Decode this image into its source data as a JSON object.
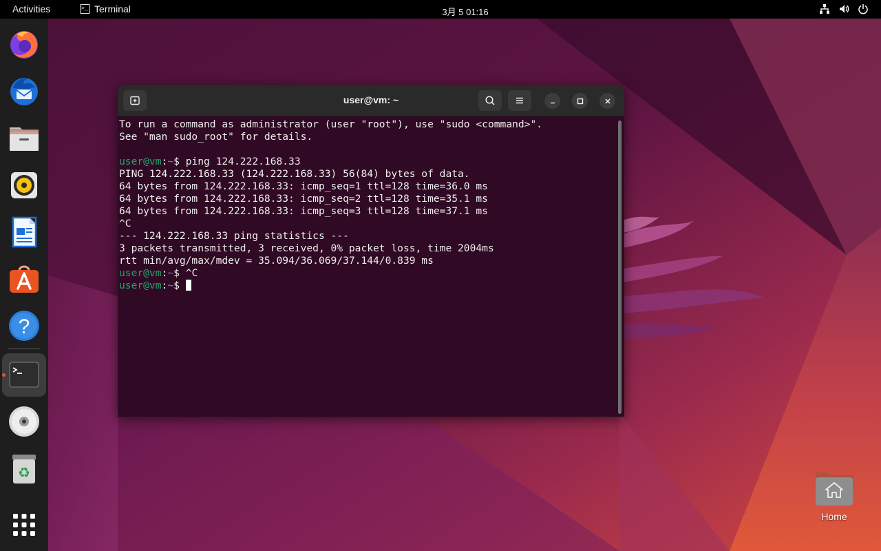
{
  "topbar": {
    "activities": "Activities",
    "app_name": "Terminal",
    "clock": "3月 5  01:16",
    "tray_icons": [
      "network-icon",
      "volume-icon",
      "power-icon"
    ]
  },
  "dock": {
    "items": [
      {
        "name": "Firefox",
        "icon": "firefox-icon"
      },
      {
        "name": "Thunderbird",
        "icon": "thunderbird-icon"
      },
      {
        "name": "Files",
        "icon": "files-icon"
      },
      {
        "name": "Rhythmbox",
        "icon": "rhythmbox-icon"
      },
      {
        "name": "LibreOffice Writer",
        "icon": "writer-icon"
      },
      {
        "name": "Ubuntu Software",
        "icon": "software-icon"
      },
      {
        "name": "Help",
        "icon": "help-icon"
      },
      {
        "name": "Terminal",
        "icon": "terminal-icon",
        "active": true
      },
      {
        "name": "Disc",
        "icon": "disc-icon"
      },
      {
        "name": "Trash",
        "icon": "trash-icon"
      },
      {
        "name": "Show Applications",
        "icon": "app-grid-icon"
      }
    ]
  },
  "terminal": {
    "title": "user@vm: ~",
    "prompt_user": "user@vm",
    "prompt_sep": ":",
    "prompt_path": "~",
    "prompt_symbol": "$",
    "lines": [
      {
        "type": "out",
        "text": "To run a command as administrator (user \"root\"), use \"sudo <command>\"."
      },
      {
        "type": "out",
        "text": "See \"man sudo_root\" for details."
      },
      {
        "type": "out",
        "text": ""
      },
      {
        "type": "prompt",
        "text": " ping 124.222.168.33"
      },
      {
        "type": "out",
        "text": "PING 124.222.168.33 (124.222.168.33) 56(84) bytes of data."
      },
      {
        "type": "out",
        "text": "64 bytes from 124.222.168.33: icmp_seq=1 ttl=128 time=36.0 ms"
      },
      {
        "type": "out",
        "text": "64 bytes from 124.222.168.33: icmp_seq=2 ttl=128 time=35.1 ms"
      },
      {
        "type": "out",
        "text": "64 bytes from 124.222.168.33: icmp_seq=3 ttl=128 time=37.1 ms"
      },
      {
        "type": "out",
        "text": "^C"
      },
      {
        "type": "out",
        "text": "--- 124.222.168.33 ping statistics ---"
      },
      {
        "type": "out",
        "text": "3 packets transmitted, 3 received, 0% packet loss, time 2004ms"
      },
      {
        "type": "out",
        "text": "rtt min/avg/max/mdev = 35.094/36.069/37.144/0.839 ms"
      },
      {
        "type": "prompt",
        "text": " ^C"
      },
      {
        "type": "prompt",
        "text": " ",
        "cursor": true
      }
    ]
  },
  "desktop": {
    "home_label": "Home"
  }
}
